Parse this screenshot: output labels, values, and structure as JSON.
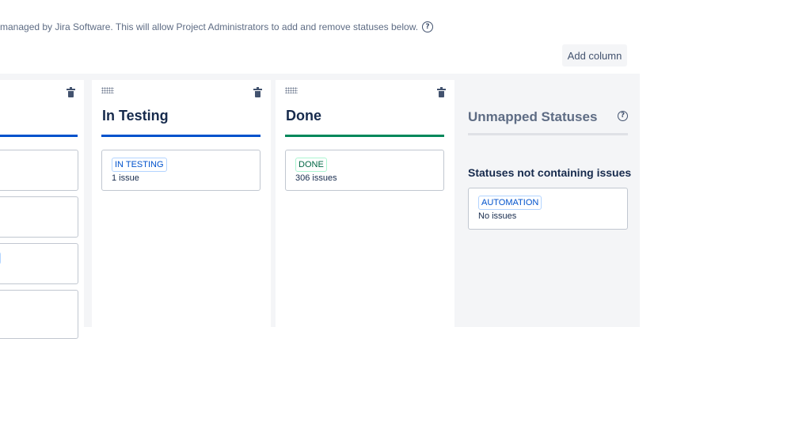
{
  "header": {
    "info_text": "managed by Jira Software. This will allow Project Administrators to add and remove statuses below.",
    "help_icon": "question-circle-icon",
    "add_column_label": "Add column"
  },
  "columns": [
    {
      "title": "In Testing",
      "accent": "#0052cc",
      "cards": [
        {
          "status": "IN TESTING",
          "count": "1 issue",
          "color": "#0052cc"
        }
      ]
    },
    {
      "title": "Done",
      "accent": "#00875a",
      "cards": [
        {
          "status": "DONE",
          "count": "306 issues",
          "color": "#006644"
        }
      ]
    }
  ],
  "unmapped": {
    "title": "Unmapped Statuses",
    "subtitle": "Statuses not containing issues",
    "cards": [
      {
        "status": "AUTOMATION",
        "count": "No issues",
        "color": "#0052cc"
      }
    ]
  },
  "icons": {
    "drag": "drag-handle-icon",
    "delete": "trash-icon"
  },
  "colors": {
    "board_background": "#f4f5f7",
    "blue_accent": "#0052cc",
    "green_accent": "#00875a",
    "unmapped_bar": "#dfe1e6"
  }
}
